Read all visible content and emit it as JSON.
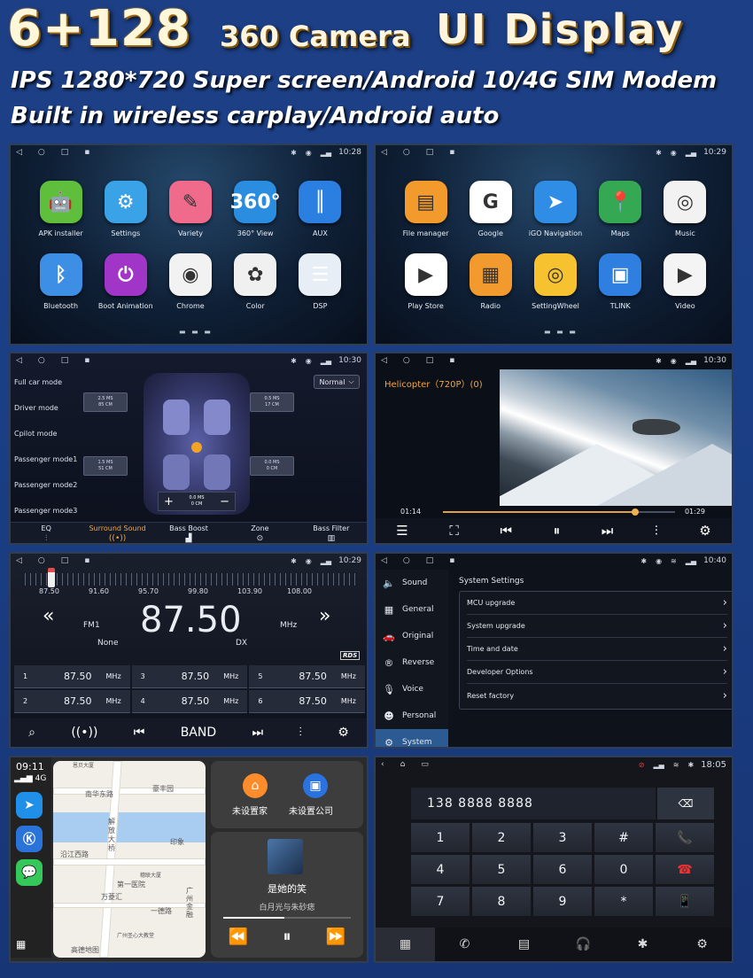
{
  "header": {
    "big": "6+128",
    "mid": "360 Camera",
    "ui": "UI Display",
    "line1": "IPS 1280*720 Super screen/Android 10/4G SIM Modem",
    "line2": "Built in wireless carplay/Android auto"
  },
  "home1": {
    "time": "10:28",
    "apps": [
      {
        "label": "APK installer",
        "color": "#5fbf3c",
        "glyph": "🤖"
      },
      {
        "label": "Settings",
        "color": "#3aa3e8",
        "glyph": "⚙"
      },
      {
        "label": "Variety",
        "color": "#f06a8c",
        "glyph": "✎"
      },
      {
        "label": "360° View",
        "color": "#2b8de0",
        "glyph": "360°"
      },
      {
        "label": "AUX",
        "color": "#2a7fe0",
        "glyph": "║"
      },
      {
        "label": "Bluetooth",
        "color": "#3d8fe6",
        "glyph": "ᛒ"
      },
      {
        "label": "Boot Animation",
        "color": "#a035c8",
        "glyph": "⏻"
      },
      {
        "label": "Chrome",
        "color": "#f2f2f2",
        "glyph": "◉"
      },
      {
        "label": "Color",
        "color": "#f0f0f0",
        "glyph": "✿"
      },
      {
        "label": "DSP",
        "color": "#e8eef6",
        "glyph": "☰"
      }
    ]
  },
  "home2": {
    "time": "10:29",
    "apps": [
      {
        "label": "File manager",
        "color": "#f39a2c",
        "glyph": "▤"
      },
      {
        "label": "Google",
        "color": "#ffffff",
        "glyph": "G"
      },
      {
        "label": "iGO Navigation",
        "color": "#2f8de6",
        "glyph": "➤"
      },
      {
        "label": "Maps",
        "color": "#35a853",
        "glyph": "📍"
      },
      {
        "label": "Music",
        "color": "#f2f2f2",
        "glyph": "◎"
      },
      {
        "label": "Play Store",
        "color": "#ffffff",
        "glyph": "▶"
      },
      {
        "label": "Radio",
        "color": "#f29a2e",
        "glyph": "▦"
      },
      {
        "label": "SettingWheel",
        "color": "#f6c230",
        "glyph": "◎"
      },
      {
        "label": "TLINK",
        "color": "#2f7fe0",
        "glyph": "▣"
      },
      {
        "label": "Video",
        "color": "#f4f4f4",
        "glyph": "▶"
      }
    ]
  },
  "sound": {
    "time": "10:30",
    "modes": [
      "Full car mode",
      "Driver mode",
      "Cpilot mode",
      "Passenger mode1",
      "Passenger mode2",
      "Passenger mode3"
    ],
    "preset": "Normal",
    "speakers": [
      {
        "a": "2.5 MS",
        "b": "85 CM"
      },
      {
        "a": "0.5 MS",
        "b": "17 CM"
      },
      {
        "a": "1.5 MS",
        "b": "51 CM"
      },
      {
        "a": "0.0 MS",
        "b": "0 CM"
      }
    ],
    "center": {
      "plus": "+",
      "minus": "−",
      "a": "0.0 MS",
      "b": "0 CM"
    },
    "tabs": [
      {
        "label": "EQ",
        "glyph": "⫶"
      },
      {
        "label": "Surround Sound",
        "glyph": "((•))"
      },
      {
        "label": "Bass Boost",
        "glyph": "▟"
      },
      {
        "label": "Zone",
        "glyph": "⊙"
      },
      {
        "label": "Bass Filter",
        "glyph": "▥"
      }
    ]
  },
  "video": {
    "time": "10:30",
    "title": "Helicopter（720P）(0)",
    "elapsed": "01:14",
    "total": "01:29",
    "progress": 0.83
  },
  "radio": {
    "time": "10:29",
    "scale": [
      "87.50",
      "91.60",
      "95.70",
      "99.80",
      "103.90",
      "108.00"
    ],
    "freq": "87.50",
    "band": "FM1",
    "unit": "MHz",
    "pty": "None",
    "dx": "DX",
    "rds": "RDS",
    "presets": [
      {
        "n": "1",
        "f": "87.50",
        "u": "MHz"
      },
      {
        "n": "3",
        "f": "87.50",
        "u": "MHz"
      },
      {
        "n": "5",
        "f": "87.50",
        "u": "MHz"
      },
      {
        "n": "2",
        "f": "87.50",
        "u": "MHz"
      },
      {
        "n": "4",
        "f": "87.50",
        "u": "MHz"
      },
      {
        "n": "6",
        "f": "87.50",
        "u": "MHz"
      }
    ],
    "band_label": "BAND"
  },
  "settings": {
    "time": "10:40",
    "side": [
      {
        "label": "Sound",
        "glyph": "🔈"
      },
      {
        "label": "General",
        "glyph": "▦"
      },
      {
        "label": "Original",
        "glyph": "🚗"
      },
      {
        "label": "Reverse",
        "glyph": "®"
      },
      {
        "label": "Voice",
        "glyph": "🎙"
      },
      {
        "label": "Personal",
        "glyph": "☻"
      },
      {
        "label": "System",
        "glyph": "⚙"
      }
    ],
    "title": "System Settings",
    "rows": [
      "MCU upgrade",
      "System upgrade",
      "Time and date",
      "Developer Options",
      "Reset factory"
    ]
  },
  "carplay": {
    "time": "09:11",
    "net": "4G",
    "map_labels": [
      "南华东路",
      "豪丰园",
      "解放大桥",
      "沿江西路",
      "第一医院",
      "广州金融",
      "万菱汇",
      "一德路",
      "广州圣心大教堂",
      "高德地图",
      "恩贝大厦",
      "穗联大厦",
      "印象"
    ],
    "home": "未设置家",
    "company": "未设置公司",
    "song": "是她的笑",
    "artist": "白月光与朱砂痣"
  },
  "dialer": {
    "time": "18:05",
    "number": "138 8888 8888",
    "keys": [
      "1",
      "2",
      "3",
      "#",
      "📞",
      "4",
      "5",
      "6",
      "0",
      "☎",
      "7",
      "8",
      "9",
      "*",
      "📱"
    ]
  }
}
